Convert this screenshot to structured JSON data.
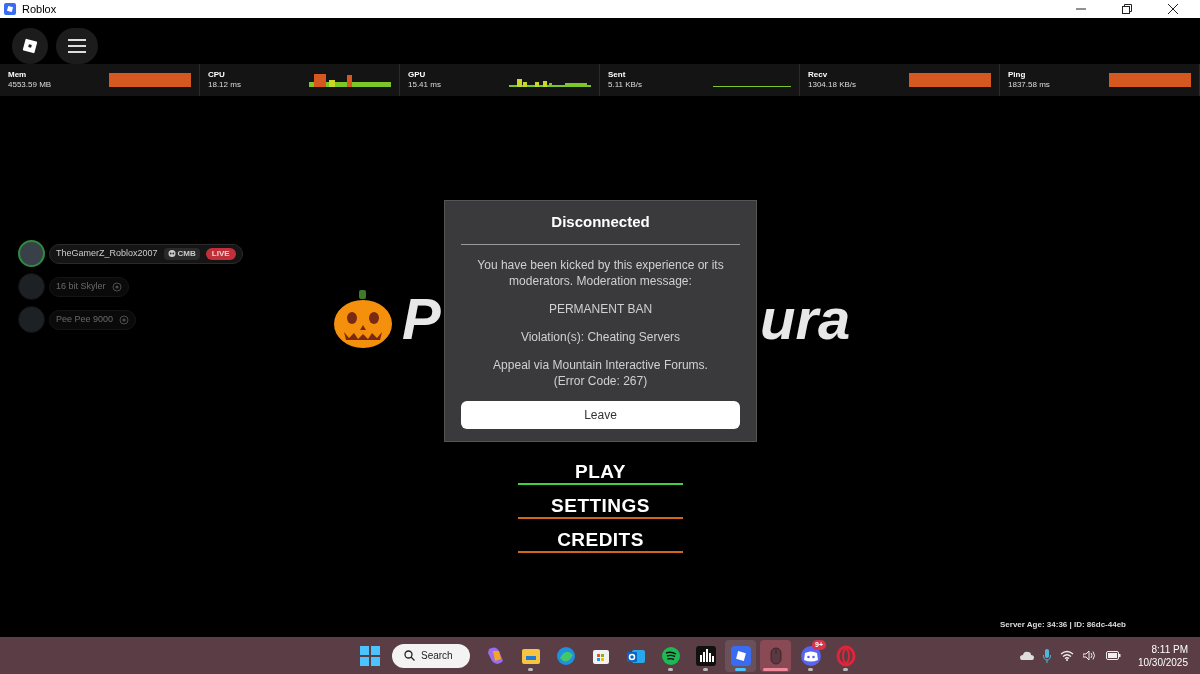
{
  "window": {
    "title": "Roblox"
  },
  "stats": [
    {
      "name": "Mem",
      "reading": "4553.59 MB",
      "kind": "full"
    },
    {
      "name": "CPU",
      "reading": "18.12 ms",
      "kind": "spikes"
    },
    {
      "name": "GPU",
      "reading": "15.41 ms",
      "kind": "bars"
    },
    {
      "name": "Sent",
      "reading": "5.11 KB/s",
      "kind": "flat"
    },
    {
      "name": "Recv",
      "reading": "1304.18 KB/s",
      "kind": "full"
    },
    {
      "name": "Ping",
      "reading": "1837.58 ms",
      "kind": "full"
    }
  ],
  "players": [
    {
      "name": "TheGamerZ_Roblox2007",
      "badge": "CMB",
      "live": "LIVE",
      "selected": true
    },
    {
      "name": "16 bit Skyler",
      "selected": false
    },
    {
      "name": "Pee Pee 9000",
      "selected": false
    }
  ],
  "game": {
    "logo_left": "P",
    "logo_right": "ura",
    "menu": [
      {
        "label": "PLAY",
        "selected": true
      },
      {
        "label": "SETTINGS",
        "selected": false
      },
      {
        "label": "CREDITS",
        "selected": false
      }
    ]
  },
  "dialog": {
    "title": "Disconnected",
    "paragraphs": [
      "You have been kicked by this experience or its moderators. Moderation message:",
      "PERMANENT BAN",
      "Violation(s): Cheating Servers",
      "Appeal via Mountain Interactive Forums.\n(Error Code: 267)"
    ],
    "button": "Leave"
  },
  "server_info": "Server Age: 34:36 | ID: 86dc-44eb",
  "taskbar": {
    "search": "Search",
    "apps": [
      {
        "kind": "copilot",
        "running": false,
        "selected": false,
        "flashing": false
      },
      {
        "kind": "folder",
        "running": true,
        "selected": false,
        "flashing": false
      },
      {
        "kind": "edge",
        "running": false,
        "selected": false,
        "flashing": false
      },
      {
        "kind": "store",
        "running": false,
        "selected": false,
        "flashing": false
      },
      {
        "kind": "mail",
        "running": false,
        "selected": false,
        "flashing": false
      },
      {
        "kind": "music",
        "running": true,
        "selected": false,
        "flashing": false
      },
      {
        "kind": "audio",
        "running": true,
        "selected": false,
        "flashing": false
      },
      {
        "kind": "roblox",
        "running": true,
        "selected": true,
        "flashing": false
      },
      {
        "kind": "mouse",
        "running": true,
        "selected": false,
        "flashing": true
      },
      {
        "kind": "chat",
        "running": true,
        "selected": false,
        "flashing": false,
        "badge": "9+"
      },
      {
        "kind": "browser",
        "running": true,
        "selected": false,
        "flashing": false
      }
    ],
    "time": "8:11 PM",
    "date": "10/30/2025"
  }
}
